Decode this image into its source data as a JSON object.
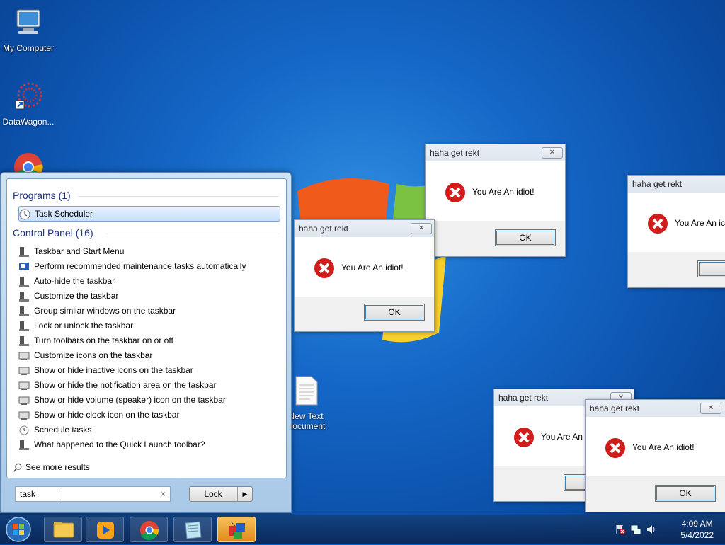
{
  "desktop": {
    "icons": [
      {
        "label": "My Computer"
      },
      {
        "label": "DataWagon..."
      },
      {
        "label": "New Text Document"
      }
    ]
  },
  "start_menu": {
    "programs_header": "Programs (1)",
    "programs": [
      "Task Scheduler"
    ],
    "control_panel_header": "Control Panel (16)",
    "control_panel": [
      "Taskbar and Start Menu",
      "Perform recommended maintenance tasks automatically",
      "Auto-hide the taskbar",
      "Customize the taskbar",
      "Group similar windows on the taskbar",
      "Lock or unlock the taskbar",
      "Turn toolbars on the taskbar on or off",
      "Customize icons on the taskbar",
      "Show or hide inactive icons on the taskbar",
      "Show or hide the notification area on the taskbar",
      "Show or hide volume (speaker) icon on the taskbar",
      "Show or hide clock icon on the taskbar",
      "Schedule tasks",
      "What happened to the Quick Launch toolbar?"
    ],
    "see_more": "See more results",
    "search_value": "task",
    "clear_symbol": "×",
    "lock_label": "Lock",
    "lock_arrow": "▶"
  },
  "dialogs": [
    {
      "title": "haha get rekt",
      "message": "You Are An idiot!",
      "ok": "OK",
      "close": "✕"
    },
    {
      "title": "haha get rekt",
      "message": "You Are An idiot!",
      "ok": "OK",
      "close": "✕"
    },
    {
      "title": "haha get rekt",
      "message": "You Are An ic",
      "ok": "O",
      "close": ""
    },
    {
      "title": "haha get rekt",
      "message": "You Are An",
      "ok": "",
      "close": "✕"
    },
    {
      "title": "haha get rekt",
      "message": "You Are An idiot!",
      "ok": "OK",
      "close": "✕"
    }
  ],
  "taskbar": {
    "time": "4:09 AM",
    "date": "5/4/2022"
  },
  "colors": {
    "error_red": "#d11c1c",
    "desktop_blue": "#1568c8"
  }
}
